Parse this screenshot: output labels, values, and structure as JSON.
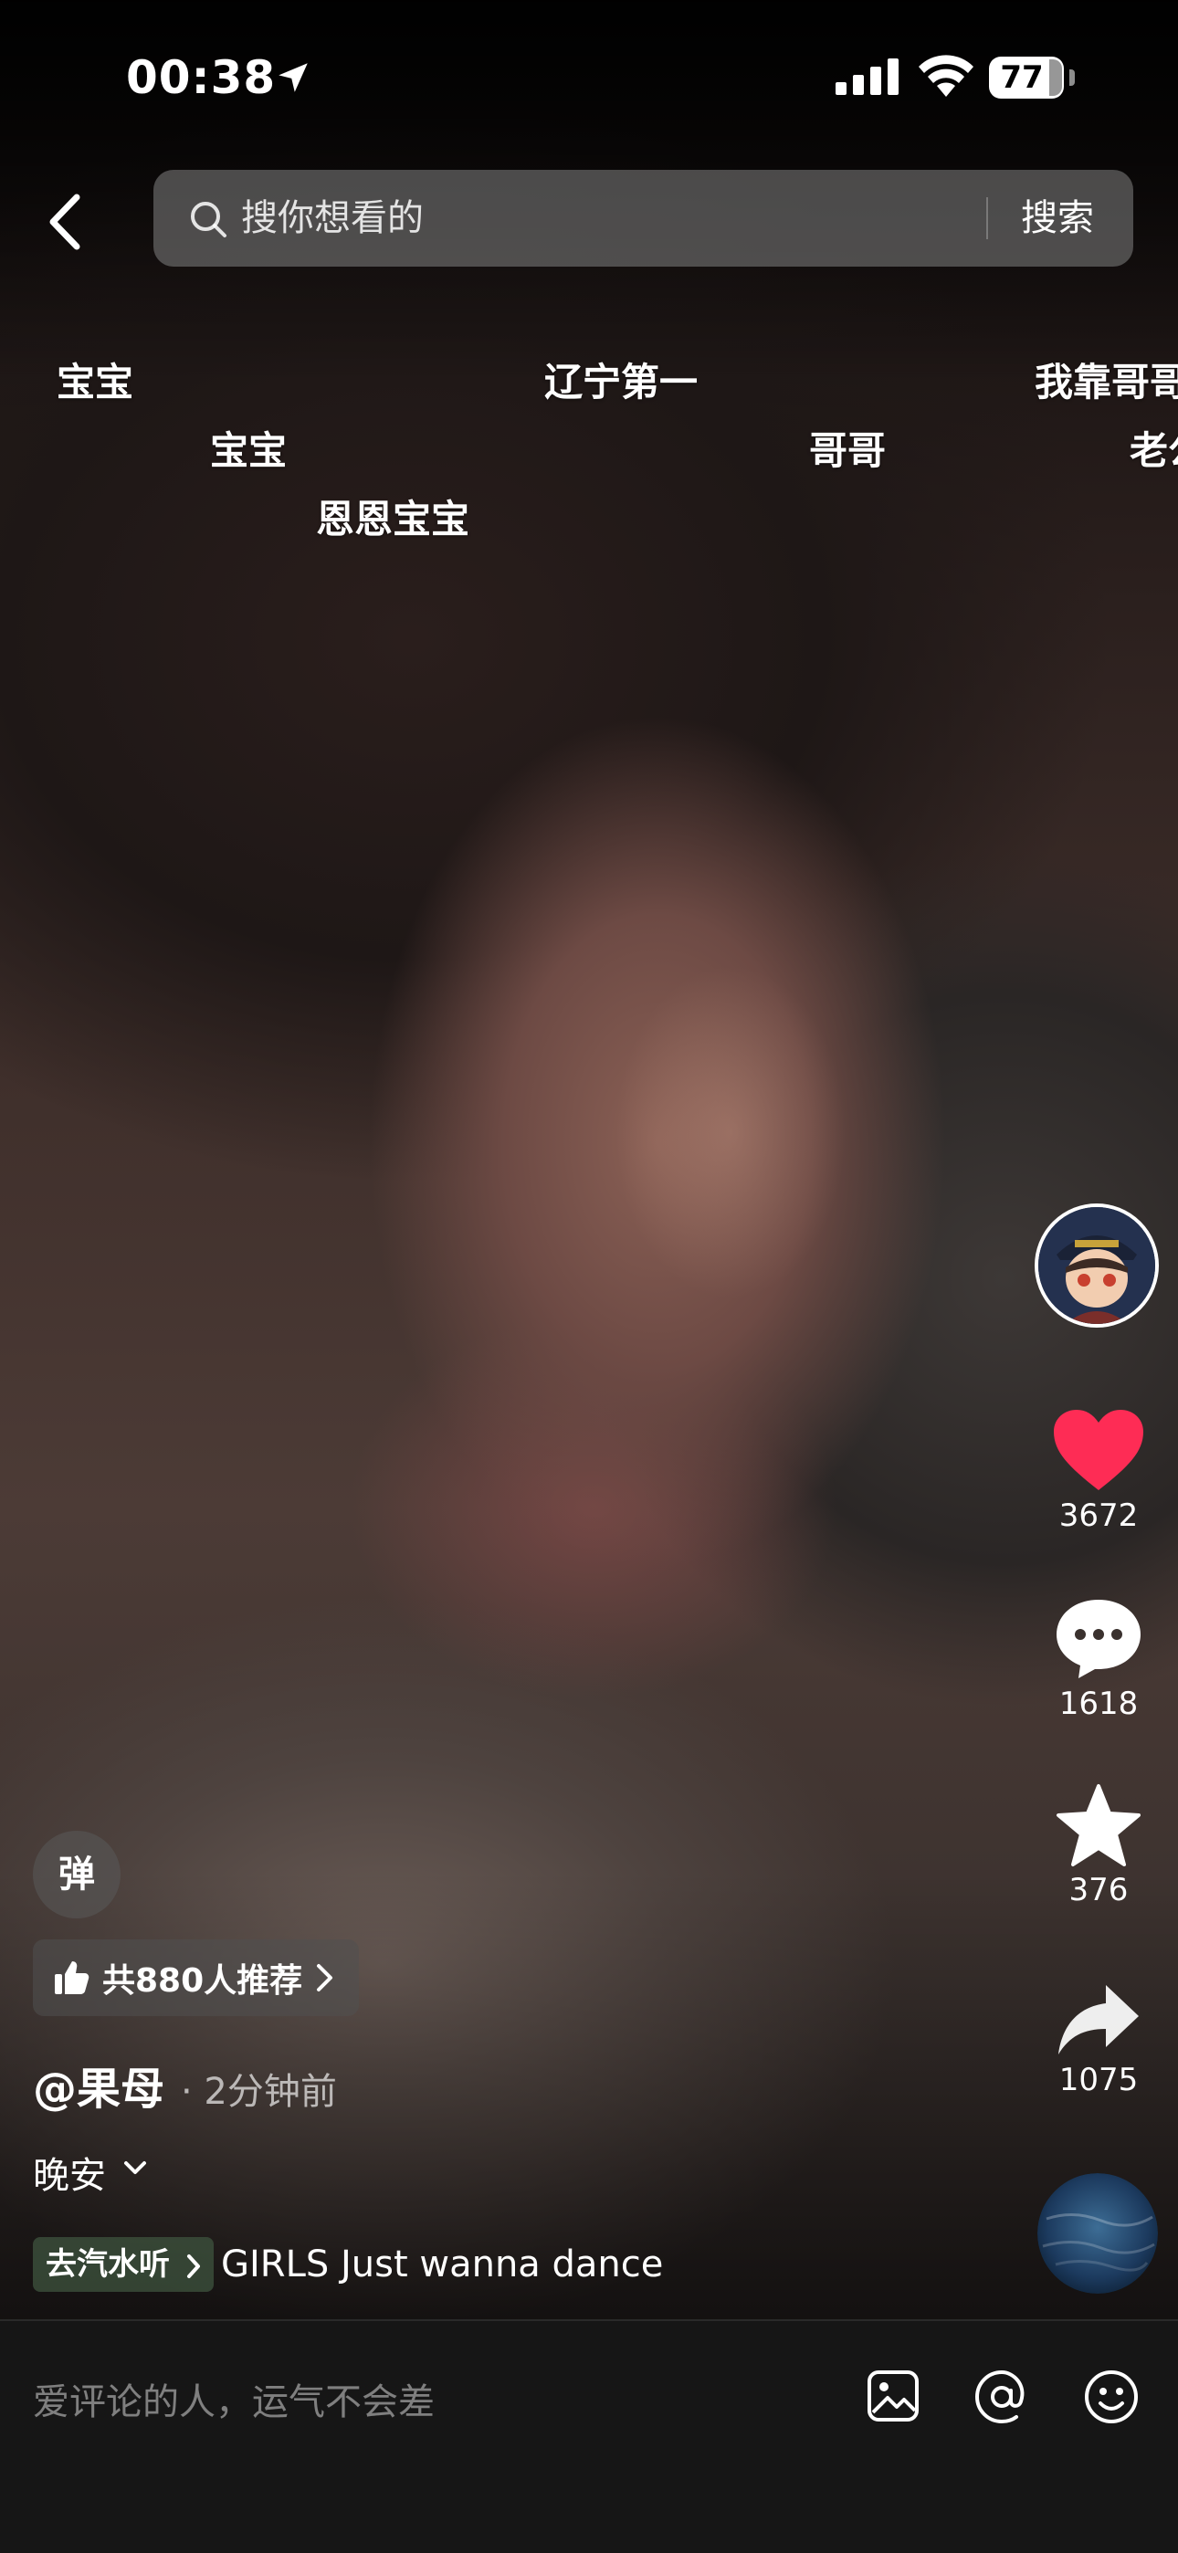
{
  "status_bar": {
    "time": "00:38",
    "battery": "77"
  },
  "search": {
    "placeholder": "搜你想看的",
    "button": "搜索"
  },
  "danmaku": [
    {
      "text": "宝宝"
    },
    {
      "text": "辽宁第一"
    },
    {
      "text": "我靠哥哥"
    },
    {
      "text": "宝宝"
    },
    {
      "text": "哥哥"
    },
    {
      "text": "老公"
    },
    {
      "text": "恩恩宝宝"
    }
  ],
  "actions": {
    "likes": "3672",
    "comments": "1618",
    "favorites": "376",
    "shares": "1075"
  },
  "colors": {
    "like": "#FE2C55",
    "background": "#000000",
    "comment_bar": "#161616"
  },
  "info": {
    "danmu_toggle": "弹",
    "recommend": "共880人推荐",
    "author": "@果母",
    "time": "· 2分钟前",
    "caption": "晚安",
    "music_tag": "去汽水听",
    "music_title": "GIRLS Just wanna dance"
  },
  "comment_bar": {
    "placeholder": "爱评论的人，运气不会差"
  },
  "icons": [
    "location-arrow-icon",
    "signal-icon",
    "wifi-icon",
    "battery-icon",
    "back-icon",
    "search-icon",
    "avatar-icon",
    "heart-icon",
    "comment-icon",
    "star-icon",
    "share-icon",
    "music-disc-icon",
    "thumbs-up-icon",
    "chevron-right-icon",
    "chevron-down-icon",
    "image-icon",
    "at-icon",
    "emoji-icon"
  ]
}
